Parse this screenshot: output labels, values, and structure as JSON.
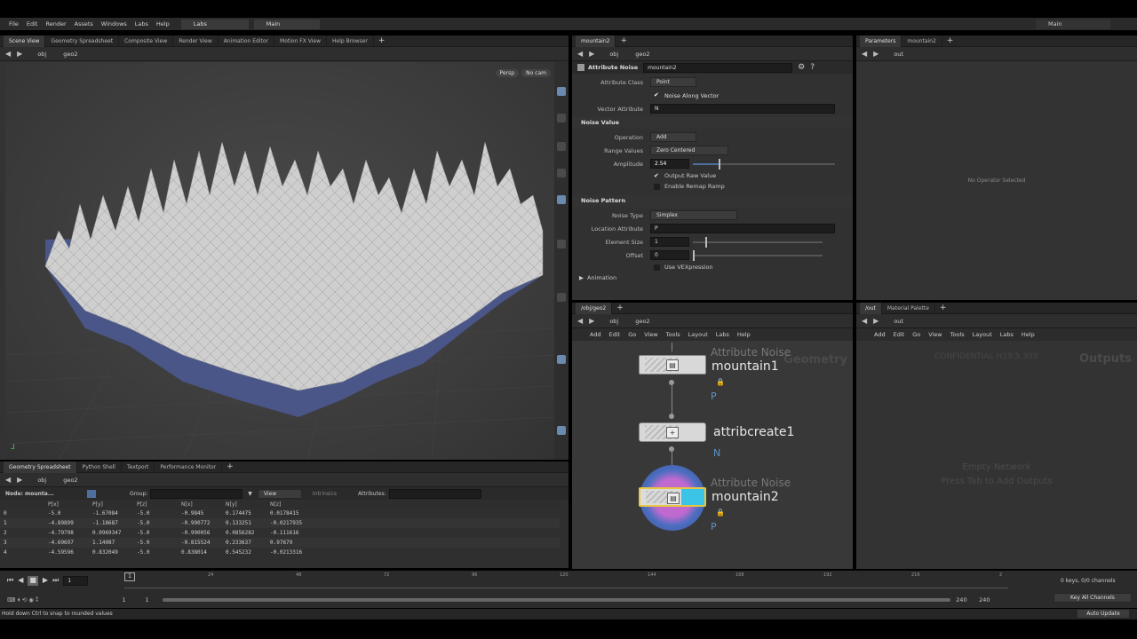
{
  "menubar": {
    "items": [
      "File",
      "Edit",
      "Render",
      "Assets",
      "Windows",
      "Labs",
      "Help"
    ],
    "desktop_label": "Labs",
    "main_label": "Main",
    "right_label": "Main"
  },
  "scene": {
    "tabs": [
      "Scene View",
      "Geometry Spreadsheet",
      "Composite View",
      "Render View",
      "Animation Editor",
      "Motion FX View",
      "Help Browser"
    ],
    "path_root": "obj",
    "path_geo": "geo2",
    "persp": "Persp",
    "camera": "No cam"
  },
  "params": {
    "tabs": [
      "mountain2"
    ],
    "path_root": "obj",
    "path_geo": "geo2",
    "node_type": "Attribute Noise",
    "node_name": "mountain2",
    "attribute_class_label": "Attribute Class",
    "attribute_class": "Point",
    "noise_along_vector": "Noise Along Vector",
    "vector_attribute_label": "Vector Attribute",
    "vector_attribute": "N",
    "section_noise_value": "Noise Value",
    "operation_label": "Operation",
    "operation": "Add",
    "range_values_label": "Range Values",
    "range_values": "Zero Centered",
    "amplitude_label": "Amplitude",
    "amplitude": "2.54",
    "amplitude_frac": 0.18,
    "output_raw": "Output Raw Value",
    "enable_remap": "Enable Remap Ramp",
    "section_noise_pattern": "Noise Pattern",
    "noise_type_label": "Noise Type",
    "noise_type": "Simplex",
    "location_attr_label": "Location Attribute",
    "location_attr": "P",
    "element_size_label": "Element Size",
    "element_size": "1",
    "offset_label": "Offset",
    "offset": "0",
    "use_vex": "Use VEXpression",
    "animation": "Animation"
  },
  "right_top": {
    "tabs": [
      "Parameters",
      "mountain2"
    ],
    "path": "out",
    "empty": "No Operator Selected"
  },
  "network": {
    "tabs": [
      "/obj/geo2"
    ],
    "path_root": "obj",
    "path_geo": "geo2",
    "menu": [
      "Add",
      "Edit",
      "Go",
      "View",
      "Tools",
      "Layout",
      "Labs",
      "Help"
    ],
    "context": "Geometry",
    "nodes": [
      {
        "type": "Attribute Noise",
        "name": "mountain1",
        "attr": "P"
      },
      {
        "type": "",
        "name": "attribcreate1",
        "attr": "N"
      },
      {
        "type": "Attribute Noise",
        "name": "mountain2",
        "attr": "P"
      }
    ]
  },
  "out_net": {
    "tabs": [
      "/out",
      "Material Palette"
    ],
    "path": "out",
    "menu": [
      "Add",
      "Edit",
      "Go",
      "View",
      "Tools",
      "Layout",
      "Labs",
      "Help"
    ],
    "watermark": "CONFIDENTIAL H19.5.303",
    "context": "Outputs",
    "empty1": "Empty Network",
    "empty2": "Press Tab to Add Outputs"
  },
  "spreadsheet": {
    "tabs": [
      "Geometry Spreadsheet",
      "Python Shell",
      "Textport",
      "Performance Monitor"
    ],
    "path_root": "obj",
    "path_geo": "geo2",
    "node_label": "Node: mounta...",
    "group_label": "Group:",
    "view_label": "View",
    "intrinsics": "Intrinsics",
    "attributes_label": "Attributes:",
    "headers": [
      "",
      "P[x]",
      "P[y]",
      "P[z]",
      "N[x]",
      "N[y]",
      "N[z]"
    ],
    "rows": [
      [
        "0",
        "-5.0",
        "-1.67084",
        "-5.0",
        "-0.9845",
        "0.174475",
        "0.0178415"
      ],
      [
        "1",
        "-4.89899",
        "-1.18687",
        "-5.0",
        "-0.990772",
        "0.133251",
        "-0.0217935"
      ],
      [
        "2",
        "-4.79798",
        "0.0969347",
        "-5.0",
        "-0.990056",
        "0.0856282",
        "-0.111616"
      ],
      [
        "3",
        "-4.69697",
        "1.14087",
        "-5.0",
        "-0.815524",
        "0.233637",
        "0.97679"
      ],
      [
        "4",
        "-4.59596",
        "0.832049",
        "-5.0",
        "0.838014",
        "0.545232",
        "-0.0213316"
      ]
    ]
  },
  "timeline": {
    "frame": "1",
    "start": "1",
    "start2": "1",
    "end": "240",
    "end2": "240",
    "ticks": [
      "24",
      "48",
      "72",
      "96",
      "120",
      "144",
      "168",
      "192",
      "216",
      "2"
    ],
    "keys": "0 keys, 0/0 channels",
    "key_all": "Key All Channels",
    "auto_update": "Auto Update"
  },
  "status": "Hold down Ctrl to snap to rounded values"
}
